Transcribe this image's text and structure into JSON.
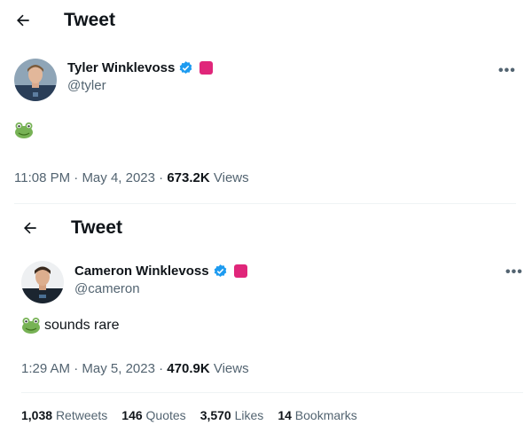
{
  "tweet1": {
    "header_title": "Tweet",
    "author_name": "Tyler Winklevoss",
    "author_handle": "@tyler",
    "time": "11:08 PM",
    "sep1": "·",
    "date": "May 4, 2023",
    "sep2": "·",
    "views_count": "673.2K",
    "views_label": "Views",
    "more_label": "•••"
  },
  "tweet2": {
    "header_title": "Tweet",
    "author_name": "Cameron Winklevoss",
    "author_handle": "@cameron",
    "text": "sounds rare",
    "time": "1:29 AM",
    "sep1": "·",
    "date": "May 5, 2023",
    "sep2": "·",
    "views_count": "470.9K",
    "views_label": "Views",
    "more_label": "•••",
    "stats": {
      "retweets_count": "1,038",
      "retweets_label": "Retweets",
      "quotes_count": "146",
      "quotes_label": "Quotes",
      "likes_count": "3,570",
      "likes_label": "Likes",
      "bookmarks_count": "14",
      "bookmarks_label": "Bookmarks"
    }
  },
  "icons": {
    "back": "arrow-left-icon",
    "verified": "verified-badge-icon",
    "affiliation": "pink-square-icon",
    "frog": "frog-emoji-icon",
    "more": "more-horizontal-icon"
  },
  "colors": {
    "text": "#0f1419",
    "secondary": "#536471",
    "verified": "#1d9bf0",
    "affiliation": "#e0267a",
    "divider": "#eff3f4"
  }
}
